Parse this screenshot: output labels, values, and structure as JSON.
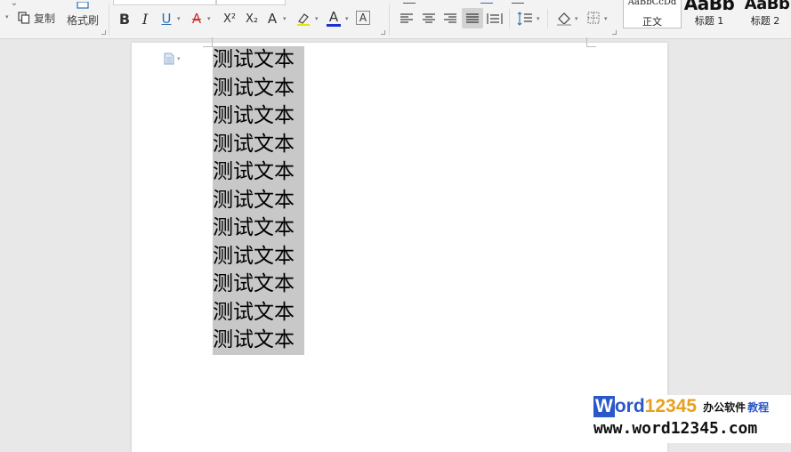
{
  "ribbon": {
    "copy_label": "复制",
    "format_painter_label": "格式刷",
    "bold_label": "B",
    "italic_label": "I",
    "underline_label": "U",
    "strike_label": "A",
    "superscript_label": "X²",
    "subscript_label": "X₂",
    "effects_label": "A",
    "font_color_label": "A",
    "char_border_label": "A",
    "font_color": "#1e32d2",
    "strike_color": "#c83232",
    "styles": {
      "normal_preview": "AaBbCcDd",
      "normal_label": "正文",
      "heading1_preview": "AaBb",
      "heading1_label": "标题 1",
      "heading2_preview": "AaBb",
      "heading2_label": "标题 2"
    }
  },
  "document": {
    "lines": [
      "测试文本",
      "测试文本",
      "测试文本",
      "测试文本",
      "测试文本",
      "测试文本",
      "测试文本",
      "测试文本",
      "测试文本",
      "测试文本",
      "测试文本"
    ],
    "selection_color": "#c8c8c8"
  },
  "watermark": {
    "brand_w": "W",
    "brand_ord": "ord",
    "brand_digits": "12345",
    "tagline": "办公软件",
    "tagline2": "教程",
    "url": "www.word12345.com"
  }
}
